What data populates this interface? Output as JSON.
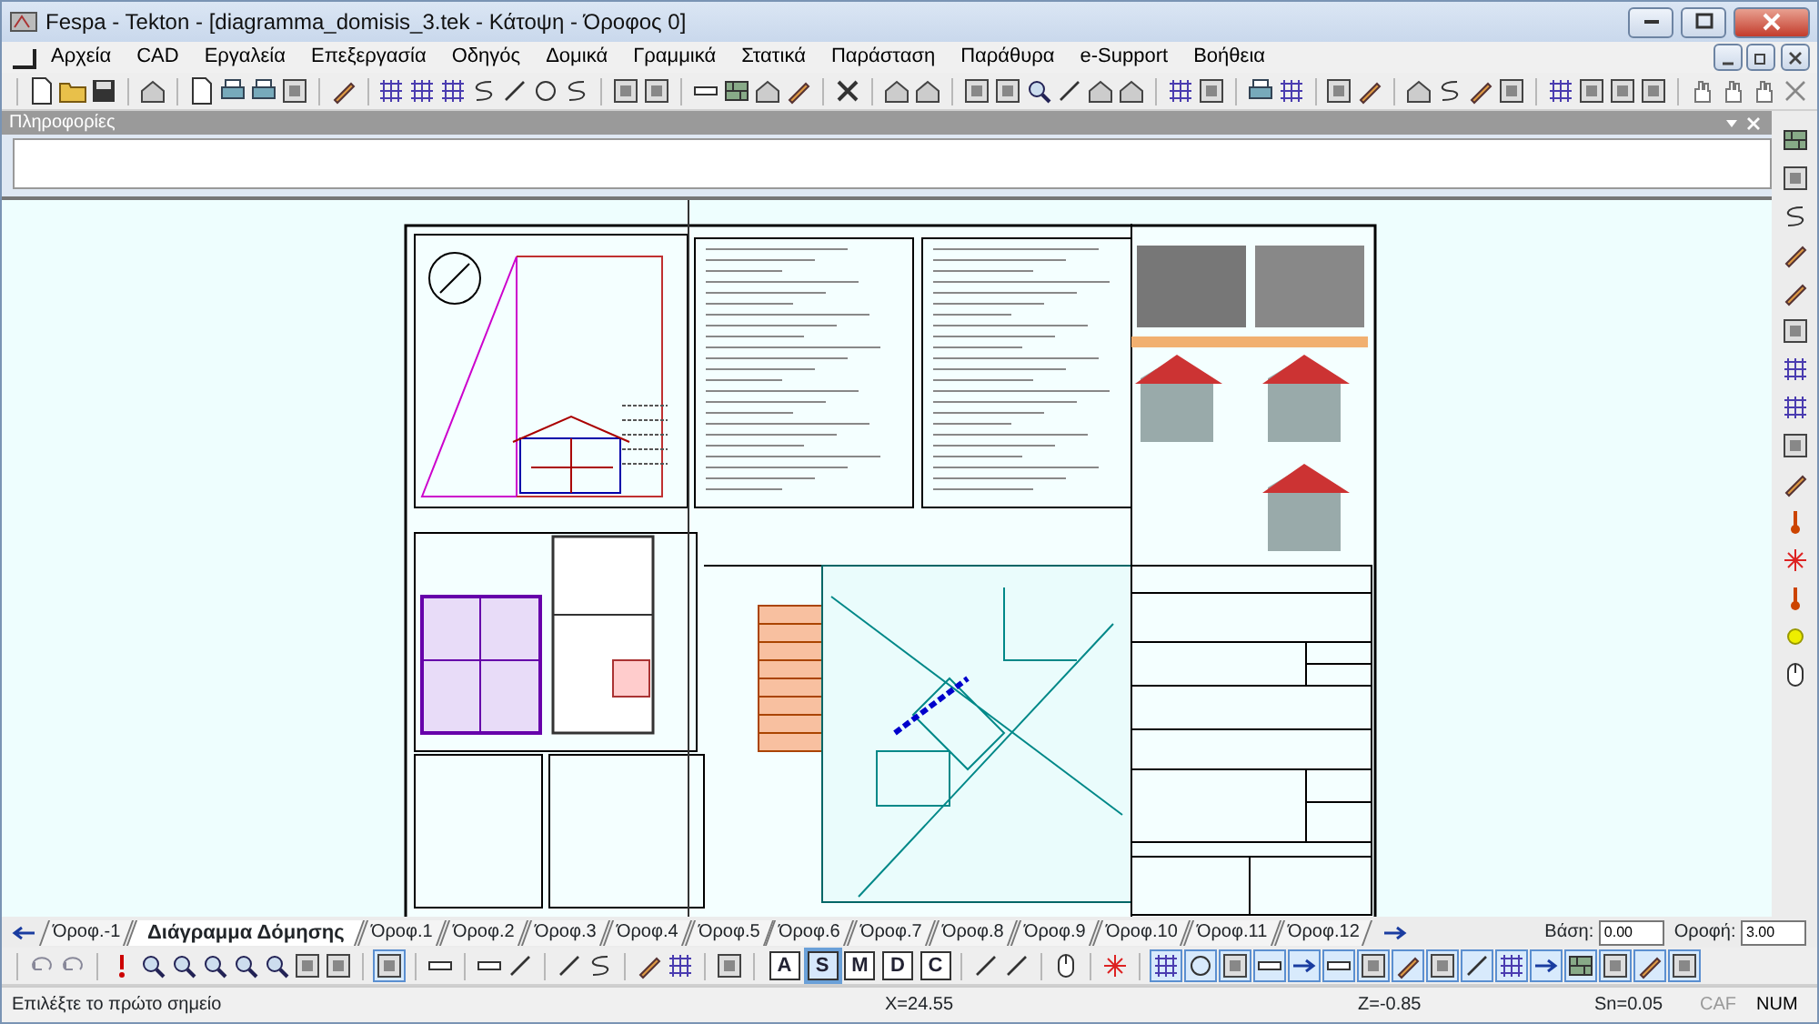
{
  "window": {
    "title": "Fespa - Tekton - [diagramma_domisis_3.tek - Κάτοψη - Όροφος 0]"
  },
  "menu": [
    "Αρχεία",
    "CAD",
    "Εργαλεία",
    "Επεξεργασία",
    "Οδηγός",
    "Δομικά",
    "Γραμμικά",
    "Στατικά",
    "Παράσταση",
    "Παράθυρα",
    "e-Support",
    "Βοήθεια"
  ],
  "info_panel": {
    "title": "Πληροφορίες"
  },
  "tabs": [
    {
      "label": "Όροφ.-1",
      "selected": false
    },
    {
      "label": "Διάγραμμα Δόμησης",
      "selected": true
    },
    {
      "label": "Όροφ.1",
      "selected": false
    },
    {
      "label": "Όροφ.2",
      "selected": false
    },
    {
      "label": "Όροφ.3",
      "selected": false
    },
    {
      "label": "Όροφ.4",
      "selected": false
    },
    {
      "label": "Όροφ.5",
      "selected": false
    },
    {
      "label": "Όροφ.6",
      "selected": false
    },
    {
      "label": "Όροφ.7",
      "selected": false
    },
    {
      "label": "Όροφ.8",
      "selected": false
    },
    {
      "label": "Όροφ.9",
      "selected": false
    },
    {
      "label": "Όροφ.10",
      "selected": false
    },
    {
      "label": "Όροφ.11",
      "selected": false
    },
    {
      "label": "Όροφ.12",
      "selected": false
    }
  ],
  "levels": [
    {
      "label": "Βάση:",
      "value": "0.00"
    },
    {
      "label": "Οροφή:",
      "value": "3.00"
    }
  ],
  "mode_buttons": [
    {
      "label": "A",
      "selected": false
    },
    {
      "label": "S",
      "selected": true
    },
    {
      "label": "M",
      "selected": false
    },
    {
      "label": "D",
      "selected": false
    },
    {
      "label": "C",
      "selected": false
    }
  ],
  "snap_toggles": [
    {
      "on": true
    },
    {
      "on": true
    },
    {
      "on": true
    },
    {
      "on": true
    },
    {
      "on": true
    },
    {
      "on": true
    },
    {
      "on": true
    },
    {
      "on": true
    },
    {
      "on": true
    },
    {
      "on": true
    },
    {
      "on": true
    },
    {
      "on": true
    },
    {
      "on": true
    },
    {
      "on": true
    },
    {
      "on": true
    },
    {
      "on": true
    }
  ],
  "status_bar": {
    "prompt": "Επιλέξτε το πρώτο σημείο",
    "x": "X=24.55",
    "z": "Z=-0.85",
    "snap": "Sn=0.05",
    "indicators": [
      {
        "label": "CAF",
        "on": false
      },
      {
        "label": "NUM",
        "on": true
      }
    ]
  }
}
